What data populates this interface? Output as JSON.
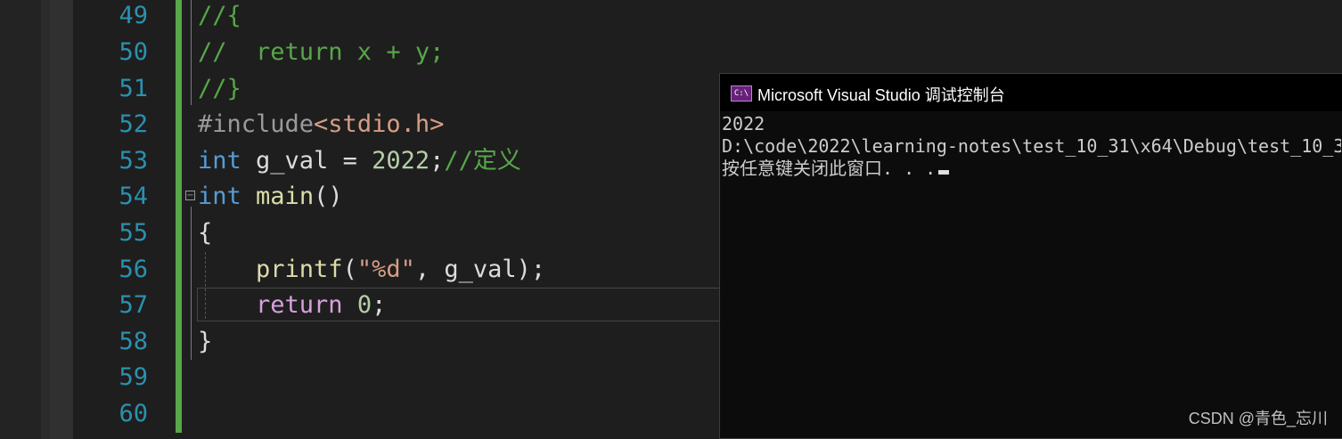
{
  "editor": {
    "line_numbers": [
      "49",
      "50",
      "51",
      "52",
      "53",
      "54",
      "55",
      "56",
      "57",
      "58",
      "59",
      "60"
    ],
    "lines": {
      "l49": {
        "comment": "//{"
      },
      "l50": {
        "comment": "//  return x + y;"
      },
      "l51": {
        "comment": "//}"
      },
      "l52": {
        "directive": "#include",
        "header": "<stdio.h>"
      },
      "l53": {
        "type": "int",
        "decl": " g_val = ",
        "value": "2022",
        "semi": ";",
        "comment": "//定义"
      },
      "l54": {
        "type": "int",
        "fn": "main",
        "parens": "()"
      },
      "l55": {
        "brace": "{"
      },
      "l56": {
        "fn": "printf",
        "open": "(",
        "string": "\"%d\"",
        "mid": ", g_val",
        "close": ");"
      },
      "l57": {
        "keyword": "return",
        "value": "0",
        "semi": ";"
      },
      "l58": {
        "brace": "}"
      }
    },
    "collapse_glyph": "−"
  },
  "console": {
    "icon_text": "C:\\",
    "title": "Microsoft Visual Studio 调试控制台",
    "output": [
      "2022",
      "D:\\code\\2022\\learning-notes\\test_10_31\\x64\\Debug\\test_10_3",
      "按任意键关闭此窗口. . ."
    ]
  },
  "watermark": "CSDN @青色_忘川",
  "colors": {
    "editor_bg": "#1e1e1e",
    "line_number": "#2b91af",
    "keyword": "#569cd6",
    "control_keyword": "#d8a0df",
    "comment": "#57a64a",
    "string": "#d69d85",
    "number": "#b5cea8",
    "function": "#dcdcaa",
    "console_bg": "#0c0c0c"
  }
}
